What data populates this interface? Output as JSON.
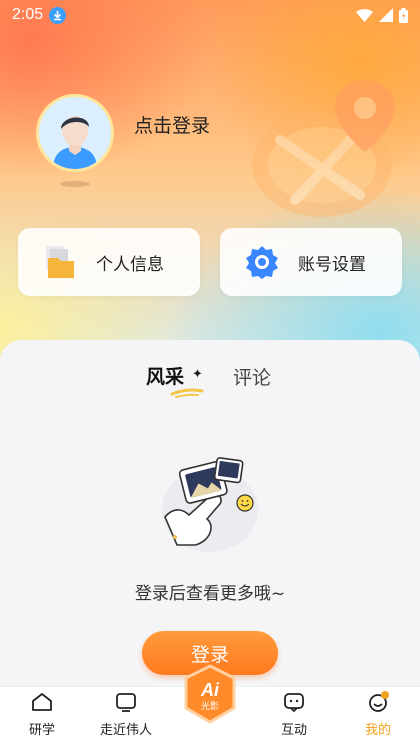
{
  "status_bar": {
    "time": "2:05"
  },
  "profile": {
    "login_prompt": "点击登录"
  },
  "quick_actions": {
    "personal_info": "个人信息",
    "account_settings": "账号设置"
  },
  "tabs": {
    "active": "风采",
    "inactive": "评论"
  },
  "empty_state": {
    "message": "登录后查看更多哦~",
    "login_button": "登录"
  },
  "bottom_nav": {
    "items": [
      {
        "label": "研学",
        "icon": "home-icon"
      },
      {
        "label": "走近伟人",
        "icon": "tv-icon"
      },
      {
        "label": "AI光影",
        "icon": "ai-badge-icon"
      },
      {
        "label": "互动",
        "icon": "chat-icon"
      },
      {
        "label": "我的",
        "icon": "profile-icon",
        "active": true
      }
    ],
    "center_badge_title": "Ai",
    "center_badge_sub": "光影"
  },
  "colors": {
    "accent": "#f2a21a",
    "button": "#ff8a2a",
    "gear": "#3a86ff"
  }
}
